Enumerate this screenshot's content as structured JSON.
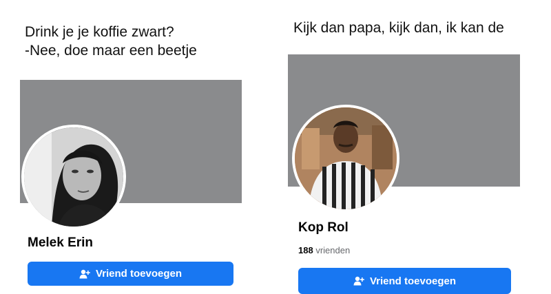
{
  "left_panel": {
    "caption_line1": "Drink je je koffie zwart?",
    "caption_line2": "-Nee, doe maar een beetje",
    "profile_name": "Melek Erin",
    "add_friend_label": "Vriend toevoegen",
    "add_friend_icon": "person-plus-icon"
  },
  "right_panel": {
    "caption": "Kijk dan papa, kijk dan, ik kan de",
    "profile_name": "Kop Rol",
    "friends_count": "188",
    "friends_label": "vrienden",
    "add_friend_label": "Vriend toevoegen",
    "add_friend_icon": "person-plus-icon"
  },
  "colors": {
    "cover_gray": "#8a8b8d",
    "button_blue": "#1877f2",
    "secondary_text": "#65676b"
  }
}
